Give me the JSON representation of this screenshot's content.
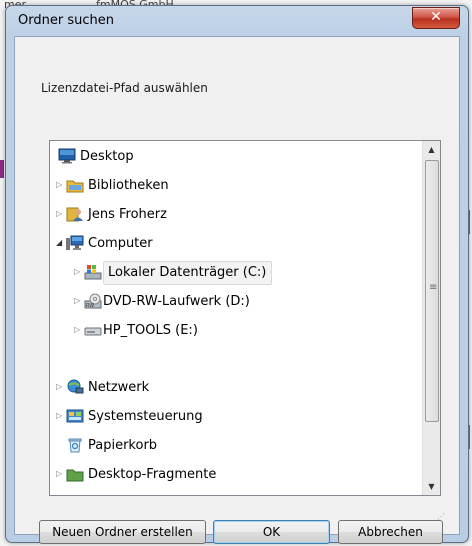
{
  "background_app": {
    "text_fragments": [
      "mer",
      "fmMOS GmbH"
    ]
  },
  "dialog": {
    "title": "Ordner suchen",
    "close_glyph": "✕",
    "prompt": "Lizenzdatei-Pfad auswählen"
  },
  "tree": {
    "items": [
      {
        "label": "Desktop",
        "icon": "desktop-icon",
        "expander": "",
        "level": 0
      },
      {
        "label": "Bibliotheken",
        "icon": "libraries-icon",
        "expander": "collapsed",
        "level": 0
      },
      {
        "label": "Jens Froherz",
        "icon": "user-folder-icon",
        "expander": "collapsed",
        "level": 0
      },
      {
        "label": "Computer",
        "icon": "computer-icon",
        "expander": "expanded",
        "level": 0
      },
      {
        "label": "Lokaler Datenträger (C:)",
        "icon": "local-drive-icon",
        "expander": "collapsed",
        "level": 1,
        "selected": true
      },
      {
        "label": "DVD-RW-Laufwerk (D:)",
        "icon": "dvd-drive-icon",
        "expander": "collapsed",
        "level": 1
      },
      {
        "label": "HP_TOOLS (E:)",
        "icon": "removable-drive-icon",
        "expander": "collapsed",
        "level": 1
      },
      {
        "label": "Netzwerk",
        "icon": "network-icon",
        "expander": "collapsed",
        "level": 0
      },
      {
        "label": "Systemsteuerung",
        "icon": "control-panel-icon",
        "expander": "collapsed",
        "level": 0
      },
      {
        "label": "Papierkorb",
        "icon": "recycle-bin-icon",
        "expander": "",
        "level": 0
      },
      {
        "label": "Desktop-Fragmente",
        "icon": "folder-icon",
        "expander": "collapsed",
        "level": 0,
        "partially_hidden": true
      }
    ]
  },
  "buttons": {
    "new_folder": "Neuen Ordner erstellen",
    "ok": "OK",
    "cancel": "Abbrechen"
  },
  "colors": {
    "close_button": "#c9453a",
    "default_button_border": "#3c7fb1",
    "selection_background": "#f3f3f3"
  }
}
